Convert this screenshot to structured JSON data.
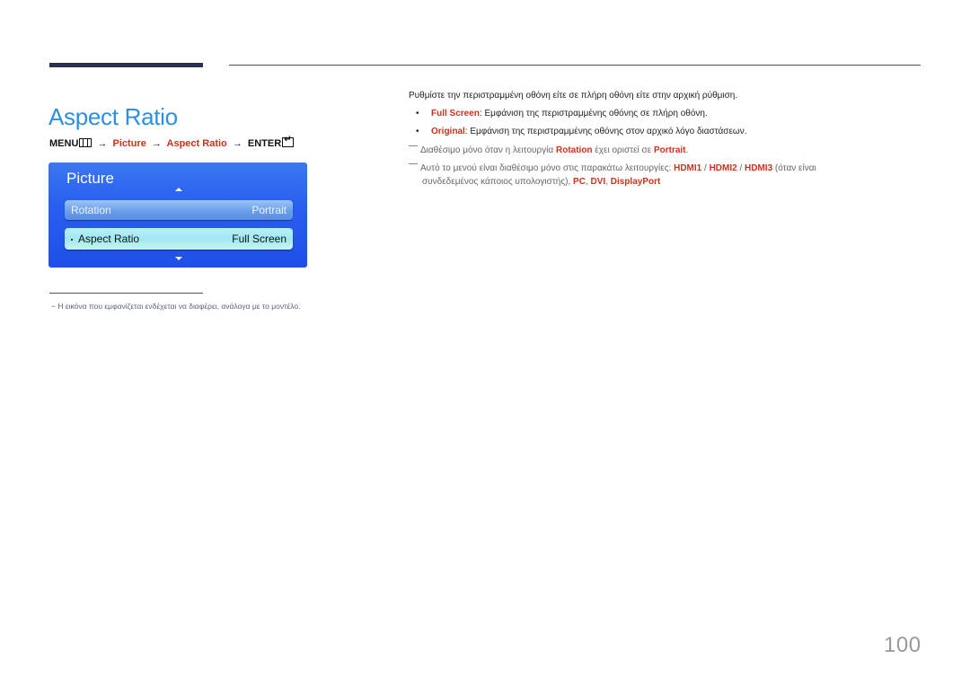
{
  "header": {
    "title": "Aspect Ratio"
  },
  "menu_path": {
    "menu": "MENU",
    "menu_icon": "menu-grid-icon",
    "arrow": "→",
    "step1": "Picture",
    "step2": "Aspect Ratio",
    "enter": "ENTER",
    "enter_icon": "enter-icon"
  },
  "osd": {
    "title": "Picture",
    "rows": [
      {
        "label": "Rotation",
        "value": "Portrait"
      },
      {
        "label": "Aspect Ratio",
        "value": "Full Screen"
      }
    ],
    "up_icon": "arrow-up-icon",
    "down_icon": "arrow-down-icon"
  },
  "footnote": {
    "text": "−  Η εικόνα που εμφανίζεται ενδέχεται να διαφέρει, ανάλογα με το μοντέλο."
  },
  "content": {
    "description": "Ρυθμίστε την περιστραμμένη οθόνη είτε σε πλήρη οθόνη είτε στην αρχική ρύθμιση.",
    "bullets": [
      {
        "term": "Full Screen",
        "text": ": Εμφάνιση της περιστραμμένης οθόνης σε πλήρη οθόνη."
      },
      {
        "term": "Original",
        "text": ": Εμφάνιση της περιστραμμένης οθόνης στον αρχικό λόγο διαστάσεων."
      }
    ],
    "note1": {
      "pre": "Διαθέσιμο μόνο όταν η λειτουργία ",
      "term1": "Rotation",
      "mid": " έχει οριστεί σε ",
      "term2": "Portrait",
      "post": "."
    },
    "note2": {
      "pre": "Αυτό το μενού είναι διαθέσιμο μόνο στις παρακάτω λειτουργίες: ",
      "hdmi1": "HDMI1",
      "sep1": " / ",
      "hdmi2": "HDMI2",
      "sep2": " / ",
      "hdmi3": "HDMI3",
      "post1": " (όταν είναι",
      "line2_pre": "συνδεδεμένος κάποιος υπολογιστής), ",
      "pc": "PC",
      "comma1": ", ",
      "dvi": "DVI",
      "comma2": ", ",
      "dp": "DisplayPort"
    }
  },
  "page_number": "100",
  "colors": {
    "title_blue": "#2b8fe6",
    "accent_red": "#c8311a",
    "osd_blue": "#2a5ff0",
    "rule_dark": "#2b3050"
  }
}
